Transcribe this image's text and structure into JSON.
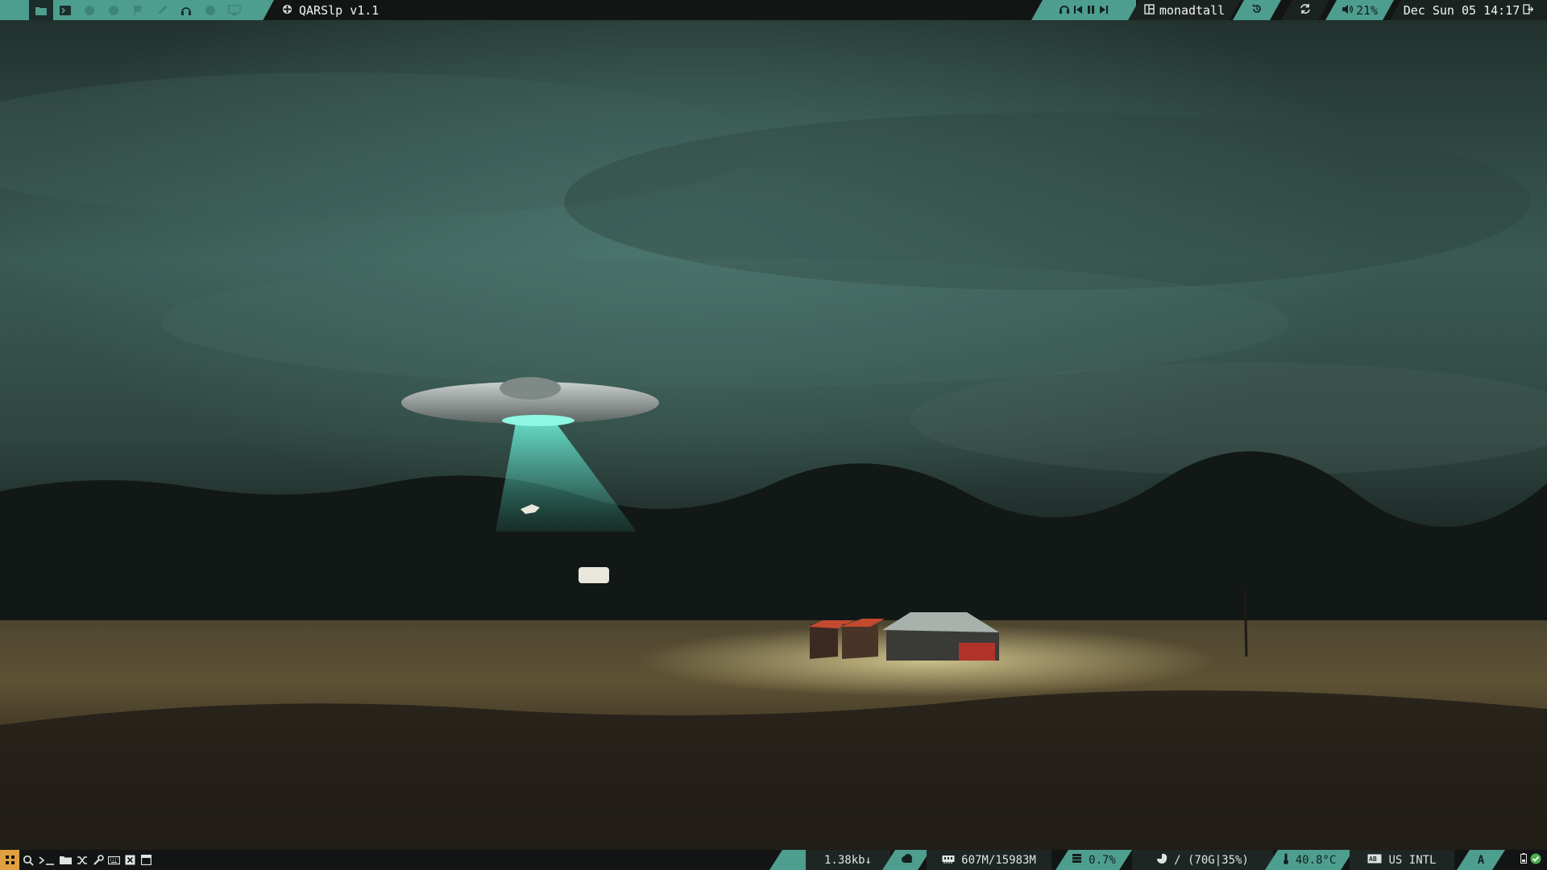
{
  "desktop": {
    "wallpaper": "ufo-abduction-over-farm-at-night"
  },
  "topbar": {
    "group_icons": [
      "folder-icon",
      "terminal-icon",
      "circle-icon",
      "circle-icon",
      "flag-icon",
      "pen-icon",
      "headphones-icon",
      "circle-icon",
      "monitor-icon"
    ],
    "active_group": 0,
    "window_title": "QARSlp v1.1",
    "layout_name": "monadtall",
    "volume": "21%",
    "clock": "Dec Sun 05 14:17"
  },
  "bottombar": {
    "net_speed": "1.38kb↓",
    "memory": "607M/15983M",
    "cpu": "0.7%",
    "disk": "/ (70G|35%)",
    "temperature": "40.8°C",
    "keyboard": "US INTL",
    "layout_letter": "A"
  },
  "colors": {
    "accent": "#4d9e8e",
    "bar_bg": "#131514",
    "menu_orange": "#e0a040",
    "tray_green": "#4caf50"
  }
}
